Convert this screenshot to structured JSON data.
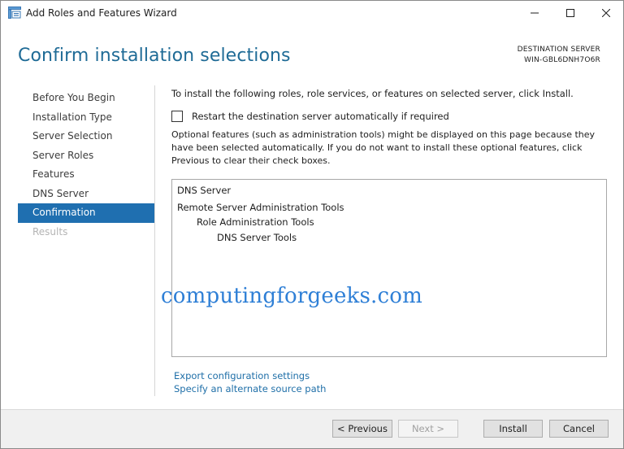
{
  "window": {
    "title": "Add Roles and Features Wizard"
  },
  "header": {
    "heading": "Confirm installation selections",
    "destination_label": "DESTINATION SERVER",
    "destination_name": "WIN-GBL6DNH7O6R"
  },
  "nav": {
    "items": [
      {
        "label": "Before You Begin",
        "state": "normal"
      },
      {
        "label": "Installation Type",
        "state": "normal"
      },
      {
        "label": "Server Selection",
        "state": "normal"
      },
      {
        "label": "Server Roles",
        "state": "normal"
      },
      {
        "label": "Features",
        "state": "normal"
      },
      {
        "label": "DNS Server",
        "state": "normal"
      },
      {
        "label": "Confirmation",
        "state": "active"
      },
      {
        "label": "Results",
        "state": "disabled"
      }
    ]
  },
  "content": {
    "intro": "To install the following roles, role services, or features on selected server, click Install.",
    "restart_label": "Restart the destination server automatically if required",
    "restart_checked": false,
    "optional_text": "Optional features (such as administration tools) might be displayed on this page because they have been selected automatically. If you do not want to install these optional features, click Previous to clear their check boxes.",
    "selections": [
      {
        "label": "DNS Server",
        "level": 0
      },
      {
        "label": "Remote Server Administration Tools",
        "level": 0
      },
      {
        "label": "Role Administration Tools",
        "level": 1
      },
      {
        "label": "DNS Server Tools",
        "level": 2
      }
    ],
    "watermark": "computingforgeeks.com",
    "links": {
      "export": "Export configuration settings",
      "alternate_source": "Specify an alternate source path"
    }
  },
  "footer": {
    "previous": "< Previous",
    "next": "Next >",
    "install": "Install",
    "cancel": "Cancel"
  },
  "colors": {
    "accent": "#1f6fb0",
    "heading": "#1f6b96",
    "link": "#1f6fa8",
    "watermark": "#2e7fd6"
  }
}
